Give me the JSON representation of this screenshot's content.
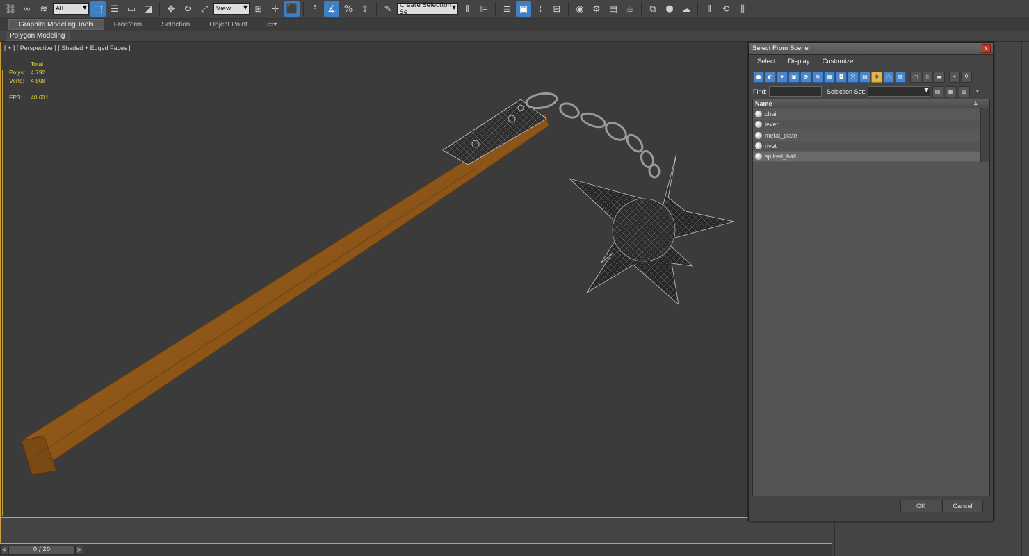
{
  "toolbar": {
    "filter_value": "All",
    "refcoord_value": "View",
    "selection_set_placeholder": "Create Selection Se"
  },
  "ribbon": {
    "tabs": [
      "Graphite Modeling Tools",
      "Freeform",
      "Selection",
      "Object Paint"
    ],
    "sub_label": "Polygon Modeling"
  },
  "viewport": {
    "label": "[ + ] [ Perspective ] [ Shaded + Edged Faces ]",
    "stats_header": "Total",
    "polys_label": "Polys:",
    "polys_value": "4 792",
    "verts_label": "Verts:",
    "verts_value": "4 808",
    "fps_label": "FPS:",
    "fps_value": "40,631"
  },
  "time_slider": {
    "value": "0 / 20",
    "prev": "<",
    "next": ">"
  },
  "dialog": {
    "title": "Select From Scene",
    "close": "x",
    "menu": [
      "Select",
      "Display",
      "Customize"
    ],
    "find_label": "Find:",
    "selection_set_label": "Selection Set:",
    "column_name": "Name",
    "items": [
      "chain",
      "lever",
      "metal_plate",
      "rivet",
      "spiked_ball"
    ],
    "ok": "OK",
    "cancel": "Cancel"
  },
  "colors": {
    "viewport_border": "#c7a13c",
    "stats_text": "#e6d43a",
    "accent_blue": "#3f7fc6",
    "wood": "#a86a1e"
  }
}
